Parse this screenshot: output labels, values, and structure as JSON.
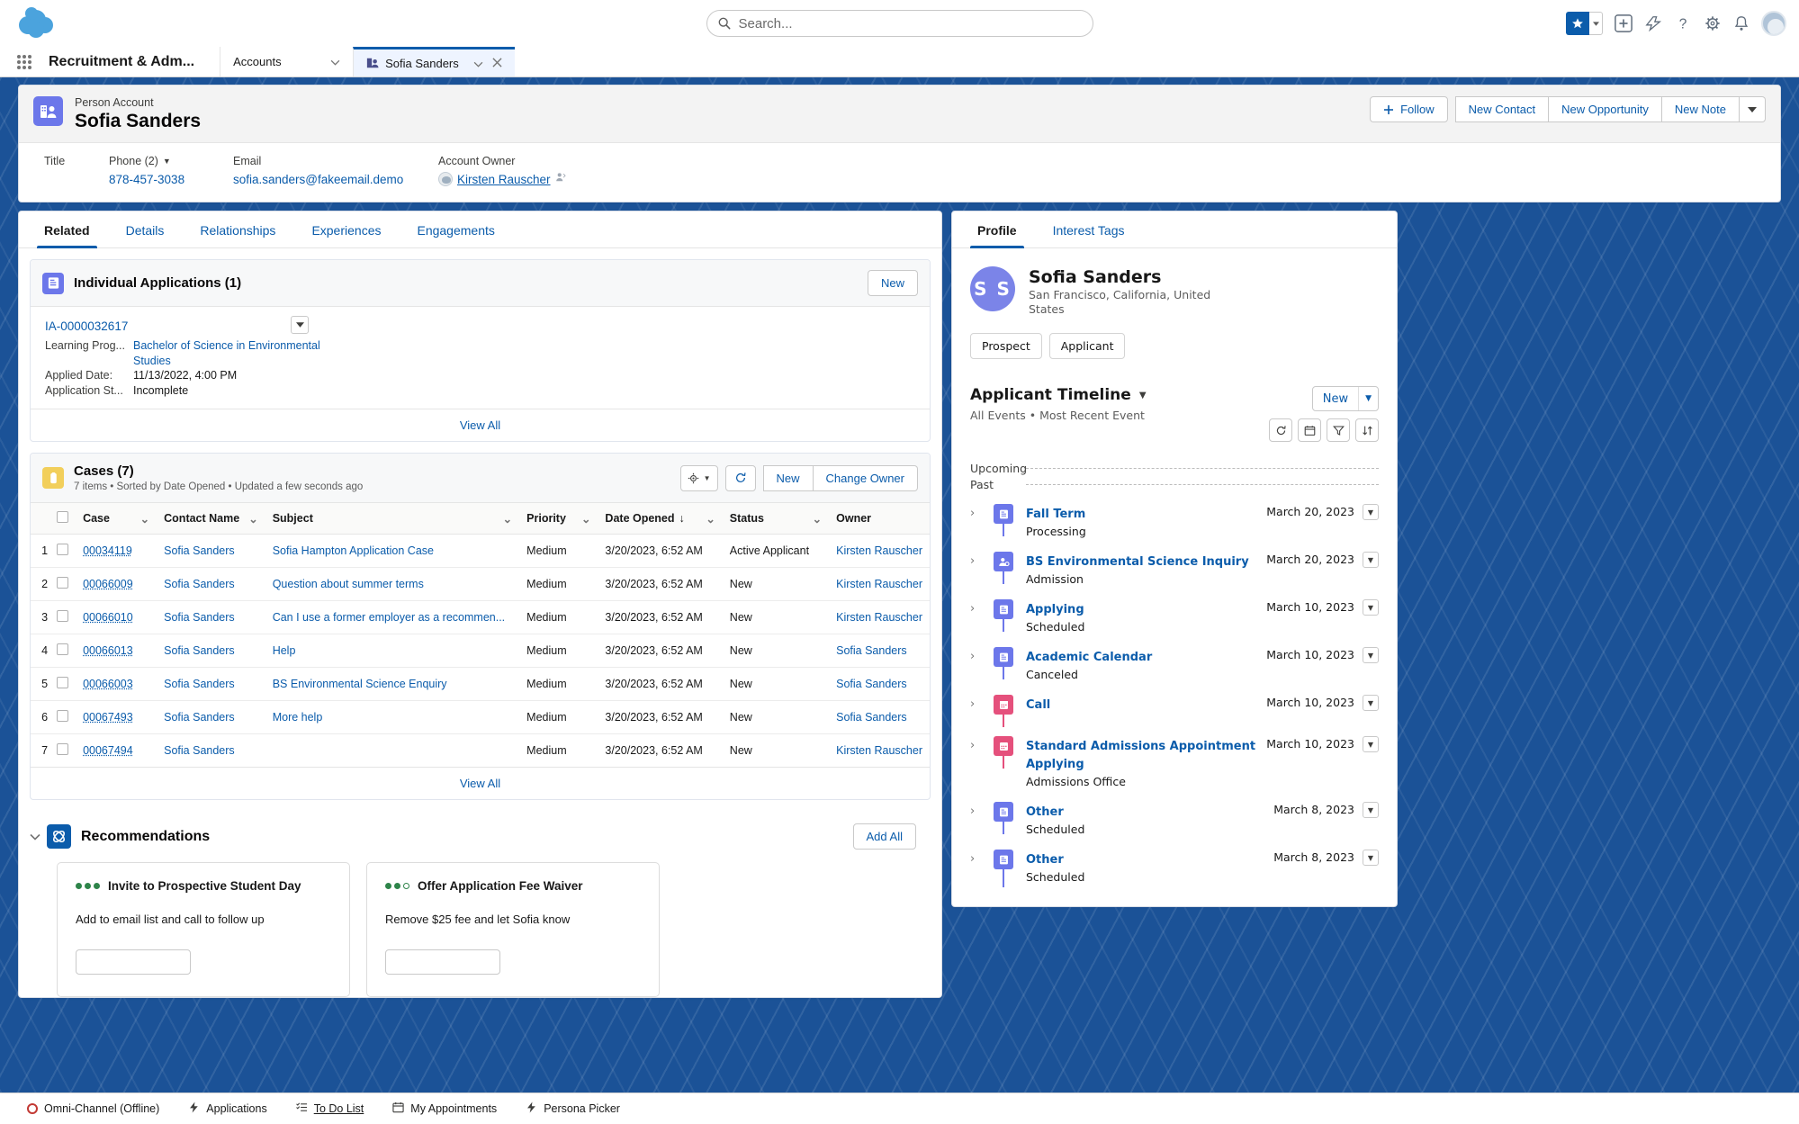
{
  "header": {
    "search_placeholder": "Search...",
    "search_icon": "search-icon",
    "favorites_icon": "star-icon",
    "add_icon": "plus-icon",
    "lightning_icon": "lightning-usage-icon",
    "help_icon": "question-mark-icon",
    "setup_icon": "gear-icon",
    "notifications_icon": "bell-icon",
    "avatar_icon": "user-avatar-icon"
  },
  "tabbar": {
    "app_launcher_icon": "app-launcher-waffle-icon",
    "app_name": "Recruitment & Adm...",
    "tabs": [
      {
        "label": "Accounts",
        "active": false,
        "closable": false
      },
      {
        "label": "Sofia Sanders",
        "active": true,
        "closable": true
      }
    ]
  },
  "highlights": {
    "record_type": "Person Account",
    "record_name": "Sofia Sanders",
    "record_icon": "person-account-icon",
    "actions": {
      "follow": "Follow",
      "follow_icon": "plus-icon",
      "new_contact": "New Contact",
      "new_opportunity": "New Opportunity",
      "new_note": "New Note",
      "more_icon": "chevron-down-icon"
    },
    "fields": [
      {
        "label": "Title",
        "value": "",
        "link": false
      },
      {
        "label": "Phone (2)",
        "value": "878-457-3038",
        "link": true,
        "has_dropdown": true
      },
      {
        "label": "Email",
        "value": "sofia.sanders@fakeemail.demo",
        "link": true
      },
      {
        "label": "Account Owner",
        "value": "Kirsten Rauscher",
        "link": true,
        "avatar": true
      }
    ]
  },
  "main": {
    "tabs": [
      {
        "label": "Related",
        "active": true
      },
      {
        "label": "Details",
        "active": false
      },
      {
        "label": "Relationships",
        "active": false
      },
      {
        "label": "Experiences",
        "active": false
      },
      {
        "label": "Engagements",
        "active": false
      }
    ],
    "individual_applications": {
      "title": "Individual Applications (1)",
      "icon": "individual-application-icon",
      "new_button": "New",
      "record_link": "IA-0000032617",
      "row_menu_icon": "chevron-down-icon",
      "fields": [
        {
          "label": "Learning Prog...",
          "value": "Bachelor of Science in Environmental Studies",
          "link": true
        },
        {
          "label": "Applied Date:",
          "value": "11/13/2022, 4:00 PM",
          "link": false
        },
        {
          "label": "Application St...",
          "value": "Incomplete",
          "link": false
        }
      ],
      "view_all": "View All"
    },
    "cases": {
      "title": "Cases (7)",
      "icon": "case-icon",
      "subtitle": "7 items • Sorted by Date Opened • Updated a few seconds ago",
      "settings_icon": "gear-icon",
      "refresh_icon": "refresh-icon",
      "new_button": "New",
      "change_owner_button": "Change Owner",
      "columns": [
        "Case",
        "Contact Name",
        "Subject",
        "Priority",
        "Date Opened",
        "Status",
        "Owner"
      ],
      "sorted_column": "Date Opened",
      "sort_direction": "desc",
      "rows": [
        {
          "n": "1",
          "case": "00034119",
          "contact": "Sofia Sanders",
          "subject": "Sofia Hampton Application Case",
          "priority": "Medium",
          "date": "3/20/2023, 6:52 AM",
          "status": "Active Applicant",
          "owner": "Kirsten Rauscher"
        },
        {
          "n": "2",
          "case": "00066009",
          "contact": "Sofia Sanders",
          "subject": "Question about summer terms",
          "priority": "Medium",
          "date": "3/20/2023, 6:52 AM",
          "status": "New",
          "owner": "Kirsten Rauscher"
        },
        {
          "n": "3",
          "case": "00066010",
          "contact": "Sofia Sanders",
          "subject": "Can I use a former employer as a recommen...",
          "priority": "Medium",
          "date": "3/20/2023, 6:52 AM",
          "status": "New",
          "owner": "Kirsten Rauscher"
        },
        {
          "n": "4",
          "case": "00066013",
          "contact": "Sofia Sanders",
          "subject": "Help",
          "priority": "Medium",
          "date": "3/20/2023, 6:52 AM",
          "status": "New",
          "owner": "Sofia Sanders"
        },
        {
          "n": "5",
          "case": "00066003",
          "contact": "Sofia Sanders",
          "subject": "BS Environmental Science Enquiry",
          "priority": "Medium",
          "date": "3/20/2023, 6:52 AM",
          "status": "New",
          "owner": "Sofia Sanders"
        },
        {
          "n": "6",
          "case": "00067493",
          "contact": "Sofia Sanders",
          "subject": "More help",
          "priority": "Medium",
          "date": "3/20/2023, 6:52 AM",
          "status": "New",
          "owner": "Sofia Sanders"
        },
        {
          "n": "7",
          "case": "00067494",
          "contact": "Sofia Sanders",
          "subject": "",
          "priority": "Medium",
          "date": "3/20/2023, 6:52 AM",
          "status": "New",
          "owner": "Kirsten Rauscher"
        }
      ],
      "view_all": "View All"
    },
    "recommendations": {
      "title": "Recommendations",
      "icon": "einstein-recommendations-icon",
      "collapse_icon": "chevron-down-icon",
      "add_all_button": "Add All",
      "cards": [
        {
          "title": "Invite to Prospective Student Day",
          "body": "Add to email list and call to follow up",
          "dots_filled": 3,
          "dots_total": 3
        },
        {
          "title": "Offer Application Fee Waiver",
          "body": "Remove $25 fee and let Sofia know",
          "dots_filled": 2,
          "dots_total": 3
        }
      ]
    }
  },
  "right_panel": {
    "tabs": [
      {
        "label": "Profile",
        "active": true
      },
      {
        "label": "Interest Tags",
        "active": false
      }
    ],
    "profile": {
      "initials": "S S",
      "name": "Sofia Sanders",
      "location": "San Francisco, California, United States",
      "pills": [
        "Prospect",
        "Applicant"
      ]
    },
    "timeline": {
      "title": "Applicant Timeline",
      "title_caret": "chevron-down-icon",
      "subtitle": "All Events • Most Recent Event",
      "new_button": "New",
      "new_caret_icon": "chevron-down-icon",
      "toolbar_icons": [
        "refresh-icon",
        "calendar-icon",
        "filter-icon",
        "sort-icon"
      ],
      "upcoming_label": "Upcoming",
      "past_label": "Past",
      "events": [
        {
          "name": "Fall Term",
          "desc": "Processing",
          "date": "March 20, 2023",
          "icon": "individual-application-icon",
          "color": "purple"
        },
        {
          "name": "BS Environmental Science Inquiry",
          "desc": "Admission",
          "date": "March 20, 2023",
          "icon": "lead-icon",
          "color": "purple"
        },
        {
          "name": "Applying",
          "desc": "Scheduled",
          "date": "March 10, 2023",
          "icon": "individual-application-icon",
          "color": "purple"
        },
        {
          "name": "Academic Calendar",
          "desc": "Canceled",
          "date": "March 10, 2023",
          "icon": "individual-application-icon",
          "color": "purple"
        },
        {
          "name": "Call",
          "desc": "",
          "date": "March 10, 2023",
          "icon": "calendar-event-icon",
          "color": "pink"
        },
        {
          "name": "Standard Admissions Appointment Applying",
          "desc": "Admissions Office",
          "date": "March 10, 2023",
          "icon": "calendar-event-icon",
          "color": "pink"
        },
        {
          "name": "Other",
          "desc": "Scheduled",
          "date": "March 8, 2023",
          "icon": "individual-application-icon",
          "color": "purple"
        },
        {
          "name": "Other",
          "desc": "Scheduled",
          "date": "March 8, 2023",
          "icon": "individual-application-icon",
          "color": "purple"
        }
      ]
    }
  },
  "utility_bar": {
    "items": [
      {
        "label": "Omni-Channel (Offline)",
        "icon": "omni-channel-icon",
        "active": false
      },
      {
        "label": "Applications",
        "icon": "lightning-bolt-icon",
        "active": false
      },
      {
        "label": "To Do List",
        "icon": "checklist-icon",
        "active": true
      },
      {
        "label": "My Appointments",
        "icon": "calendar-icon",
        "active": false
      },
      {
        "label": "Persona Picker",
        "icon": "lightning-bolt-icon",
        "active": false
      }
    ]
  },
  "colors": {
    "brand_blue": "#0b5cab",
    "page_background": "#1b5297",
    "purple_icon": "#6c77ea",
    "pink_icon": "#e5507c",
    "yellow_icon": "#f2cf5b",
    "green_dot": "#2e844a",
    "error_red": "#c23934"
  }
}
